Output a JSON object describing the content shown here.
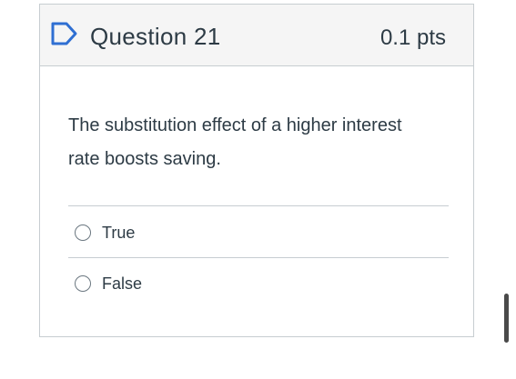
{
  "question": {
    "title": "Question 21",
    "points": "0.1 pts",
    "text": "The substitution effect of a higher interest rate boosts saving.",
    "flag_icon": "flag-icon",
    "options": [
      {
        "label": "True",
        "selected": false
      },
      {
        "label": "False",
        "selected": false
      }
    ]
  },
  "colors": {
    "header_background": "#f5f5f5",
    "border": "#c7cdd1",
    "text": "#2d3b45",
    "flag": "#2f6fd2"
  }
}
